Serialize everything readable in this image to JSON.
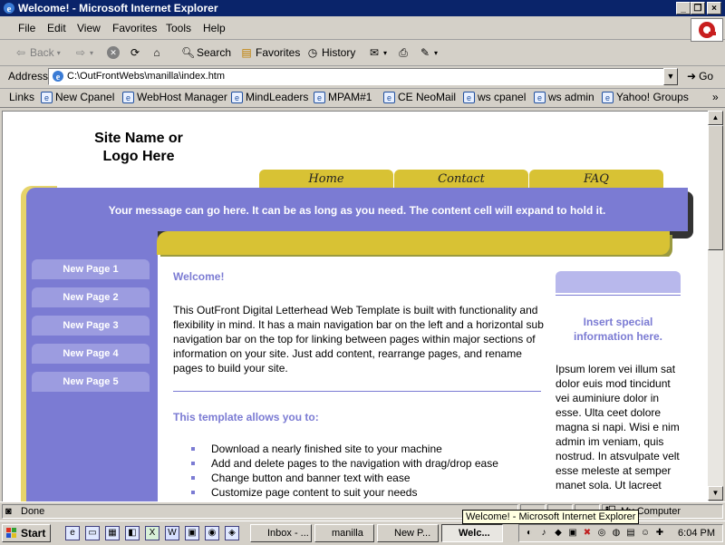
{
  "window": {
    "title": "Welcome! - Microsoft Internet Explorer"
  },
  "menu": [
    "File",
    "Edit",
    "View",
    "Favorites",
    "Tools",
    "Help"
  ],
  "toolbar": {
    "back": "Back",
    "search": "Search",
    "favorites": "Favorites",
    "history": "History"
  },
  "address": {
    "label": "Address",
    "url": "C:\\OutFrontWebs\\manilla\\index.htm",
    "go": "Go"
  },
  "links": {
    "label": "Links",
    "items": [
      "New Cpanel",
      "WebHost Manager",
      "MindLeaders",
      "MPAM#1",
      "CE NeoMail",
      "ws cpanel",
      "ws admin",
      "Yahoo! Groups"
    ],
    "more": "»"
  },
  "page": {
    "site_name": "Site Name or Logo Here",
    "nav": [
      "Home",
      "Contact",
      "FAQ"
    ],
    "banner": "Your message can go here.  It can be as long as you need.  The content cell will expand to hold it.",
    "left_nav": [
      "New Page 1",
      "New Page 2",
      "New Page 3",
      "New Page 4",
      "New Page 5"
    ],
    "welcome": "Welcome!",
    "intro": "This OutFront Digital Letterhead Web Template is built with functionality and flexibility in mind.  It has a main navigation bar on the left and a horizontal sub navigation bar on the top for linking between pages within major sections of information on your site.  Just add content, rearrange pages, and rename pages to build your site.",
    "allows_heading": "This template allows you to:",
    "bullets": [
      "Download a nearly finished site to your machine",
      "Add and delete pages to the navigation with drag/drop ease",
      "Change button and banner text with ease",
      "Customize page content to suit your needs"
    ],
    "side_heading": "Insert special information here.",
    "side_text": "Ipsum lorem vei illum sat dolor euis mod tincidunt vei auminiure dolor in esse. Ulta ceet dolore magna si napi. Wisi e nim admin im veniam, quis nostrud. In atsvulpate velt esse meleste at semper manet sola. Ut lacreet"
  },
  "status": {
    "text": "Done",
    "zone": "My Computer"
  },
  "taskbar": {
    "start": "Start",
    "tasks": [
      "Inbox - ...",
      "manilla",
      "New P...",
      "Welc..."
    ],
    "clock": "6:04 PM",
    "tooltip": "Welcome! - Microsoft Internet Explorer"
  },
  "colors": {
    "title_bar": "#0a246a",
    "banner": "#7b7bd3",
    "nav_gold": "#d8c234",
    "left_nav_button": "#9c9ce0",
    "accent_text": "#7b7bd3"
  }
}
